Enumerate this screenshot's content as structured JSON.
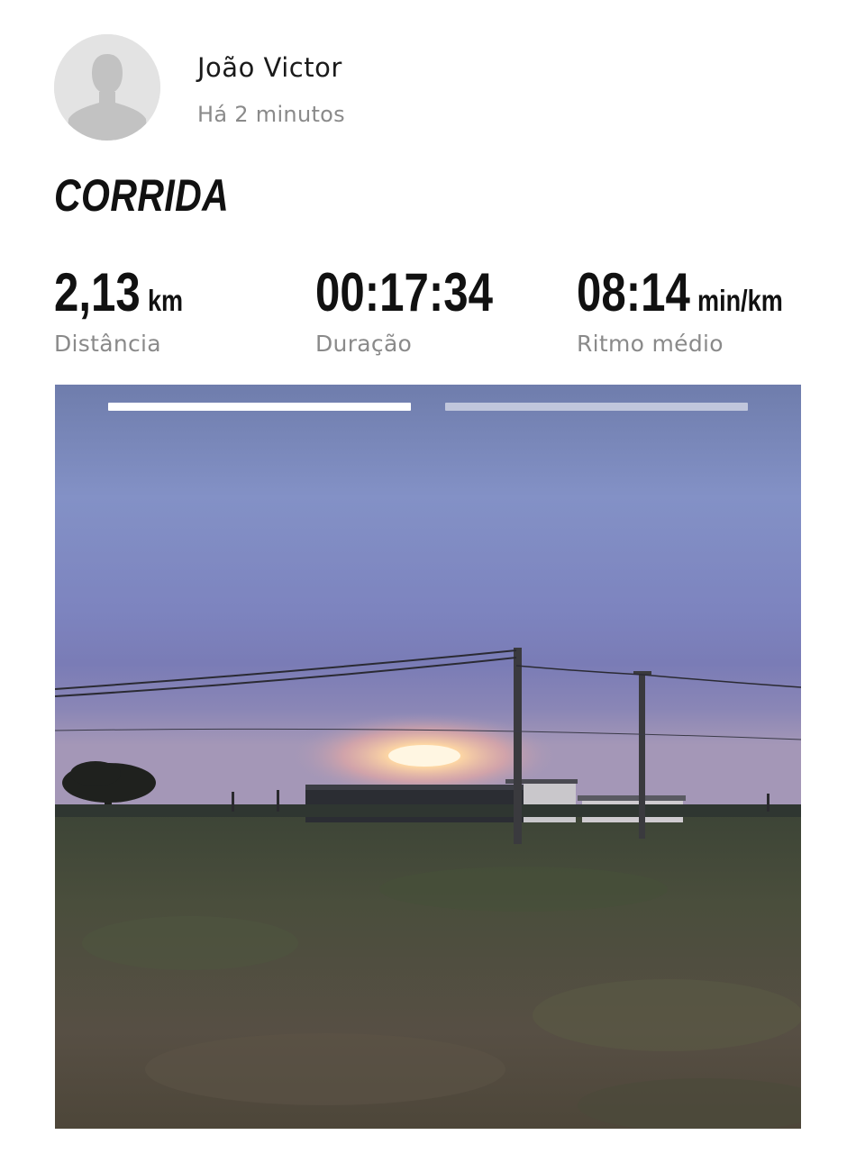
{
  "post": {
    "user_name": "João Victor",
    "time_ago": "Há 2 minutos",
    "activity_type": "CORRIDA"
  },
  "stats": {
    "distance": {
      "value": "2,13",
      "unit": "km",
      "label": "Distância"
    },
    "duration": {
      "value": "00:17:34",
      "unit": "",
      "label": "Duração"
    },
    "pace": {
      "value": "08:14",
      "unit": "min/km",
      "label": "Ritmo médio"
    }
  },
  "photo_carousel": {
    "slide_count": 2,
    "active_slide": 1
  },
  "colors": {
    "text_primary": "#111111",
    "text_secondary": "#8a8a8a",
    "avatar_bg": "#e3e3e3",
    "avatar_silhouette": "#c2c2c2"
  }
}
